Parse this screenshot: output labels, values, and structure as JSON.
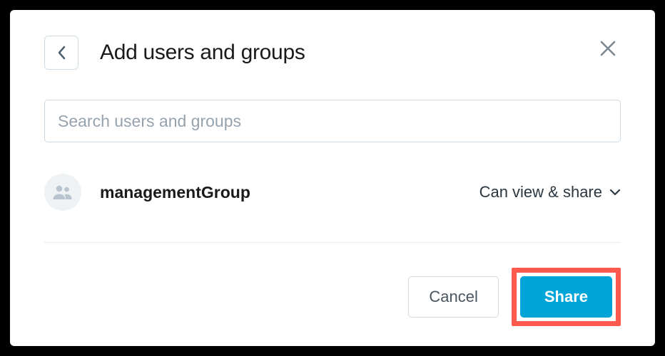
{
  "header": {
    "title": "Add users and groups"
  },
  "search": {
    "placeholder": "Search users and groups",
    "value": ""
  },
  "entry": {
    "name": "managementGroup",
    "permission": "Can view & share"
  },
  "footer": {
    "cancel_label": "Cancel",
    "share_label": "Share"
  }
}
